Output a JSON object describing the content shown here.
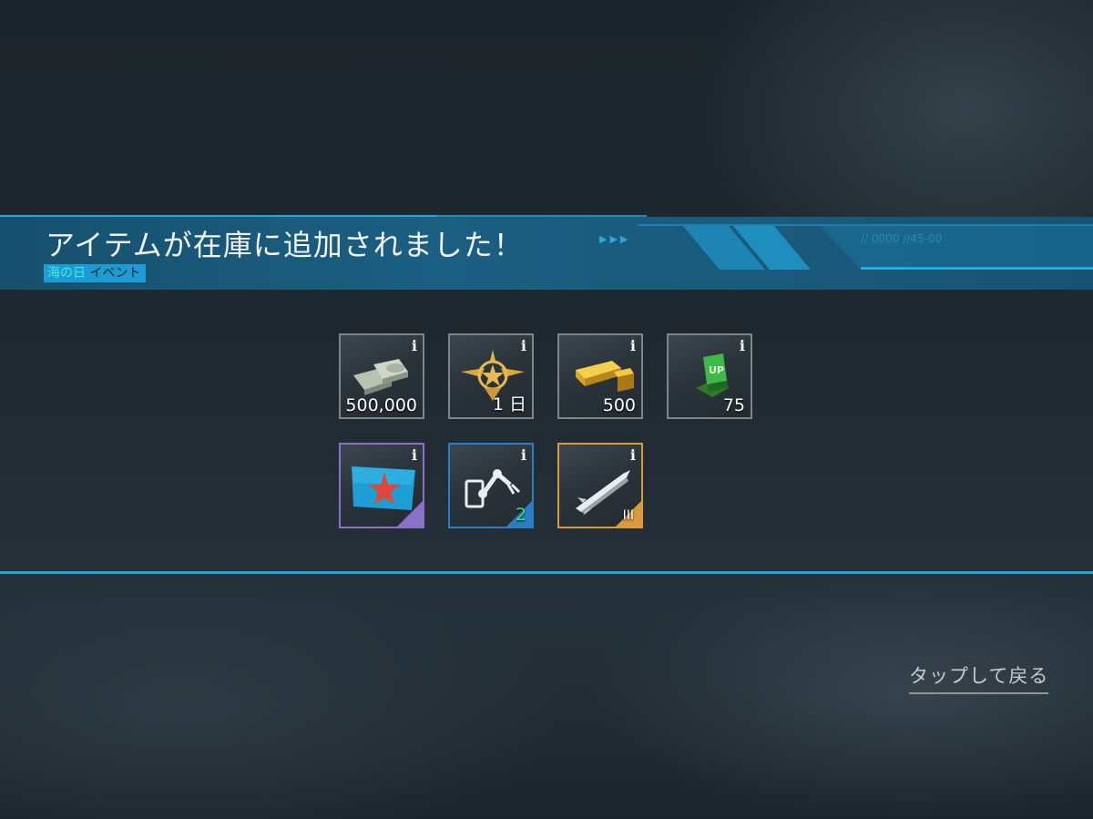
{
  "header": {
    "title": "アイテムが在庫に追加されました！",
    "subtitle_highlight": "海の日",
    "subtitle_rest": "イベント",
    "arrows": "▶▶▶",
    "code": "// 0000 //45-00"
  },
  "items": [
    {
      "icon": "money-bundle-icon",
      "qty": "500,000",
      "rarity": "common"
    },
    {
      "icon": "premium-emblem-icon",
      "qty": "1 日",
      "rarity": "common"
    },
    {
      "icon": "gold-bars-icon",
      "qty": "500",
      "rarity": "common"
    },
    {
      "icon": "upgrade-module-icon",
      "qty": "75",
      "rarity": "common"
    },
    {
      "icon": "starfish-flag-icon",
      "qty": "",
      "rarity": "epic"
    },
    {
      "icon": "robotic-arm-icon",
      "qty": "2",
      "rarity": "rare"
    },
    {
      "icon": "missile-icon",
      "qty": "III",
      "rarity": "legendary"
    }
  ],
  "info_label": "i",
  "footer": {
    "back_label": "タップして戻る"
  },
  "colors": {
    "accent": "#21a4dc",
    "epic": "#8b72c9",
    "rare": "#2a7fc4",
    "legendary": "#d99a3d"
  }
}
